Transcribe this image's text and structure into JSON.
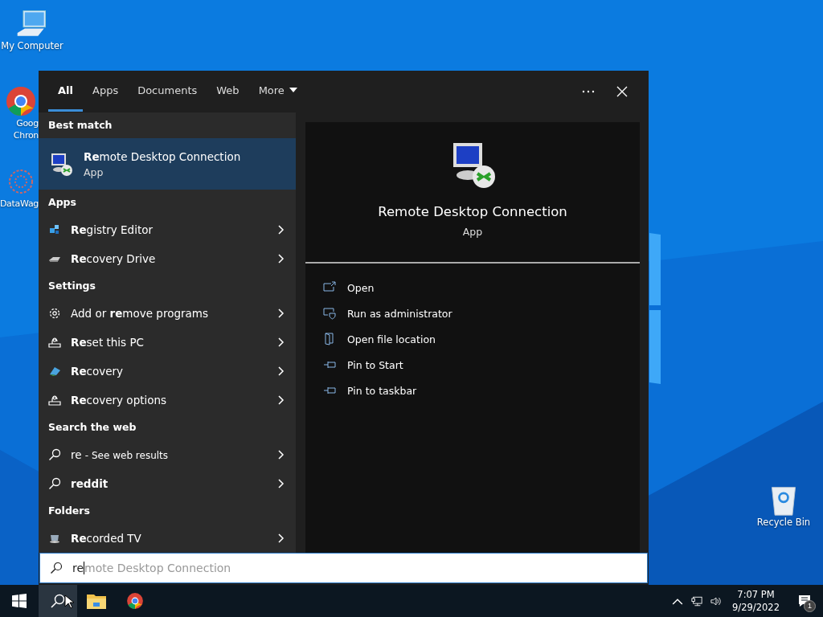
{
  "desktop_icons": [
    {
      "kind": "computer",
      "lines": [
        "My Computer"
      ]
    },
    {
      "kind": "chrome",
      "lines": [
        "Goog",
        "Chron"
      ]
    },
    {
      "kind": "network",
      "lines": [
        "DataWag"
      ]
    },
    {
      "kind": "recycle",
      "lines": [
        "Recycle Bin"
      ]
    }
  ],
  "search_panel": {
    "tabs": [
      {
        "label": "All",
        "selected": true
      },
      {
        "label": "Apps",
        "selected": false
      },
      {
        "label": "Documents",
        "selected": false
      },
      {
        "label": "Web",
        "selected": false
      },
      {
        "label": "More",
        "selected": false,
        "dropdown": true
      }
    ],
    "sections": [
      {
        "heading": "Best match",
        "items": [
          {
            "kind": "rdp",
            "label": "**Re**mote Desktop Connection",
            "subtitle": "App",
            "selected": true,
            "submenu": false
          }
        ]
      },
      {
        "heading": "Apps",
        "items": [
          {
            "kind": "registry",
            "label": "**Re**gistry Editor",
            "selected": false,
            "submenu": true
          },
          {
            "kind": "drive",
            "label": "**Re**covery Drive",
            "selected": false,
            "submenu": true
          }
        ]
      },
      {
        "heading": "Settings",
        "items": [
          {
            "kind": "gear",
            "label": "Add or **re**move programs",
            "selected": false,
            "submenu": true
          },
          {
            "kind": "reset",
            "label": "**Re**set this PC",
            "selected": false,
            "submenu": true
          },
          {
            "kind": "recovery",
            "label": "**Re**covery",
            "selected": false,
            "submenu": true
          },
          {
            "kind": "reset",
            "label": "**Re**covery options",
            "selected": false,
            "submenu": true
          }
        ]
      },
      {
        "heading": "Search the web",
        "items": [
          {
            "kind": "search",
            "label": "re",
            "suffix": "- See web results",
            "selected": false,
            "submenu": true
          },
          {
            "kind": "search",
            "label": "**reddit**",
            "selected": false,
            "submenu": true
          }
        ]
      },
      {
        "heading": "Folders",
        "items": [
          {
            "kind": "tv",
            "label": "**Re**corded TV",
            "selected": false,
            "submenu": true
          }
        ]
      }
    ],
    "preview": {
      "kind": "rdp",
      "title": "Remote Desktop Connection",
      "subtitle": "App",
      "actions": [
        {
          "kind": "open",
          "label": "Open"
        },
        {
          "kind": "admin",
          "label": "Run as administrator"
        },
        {
          "kind": "folder",
          "label": "Open file location"
        },
        {
          "kind": "pin",
          "label": "Pin to Start"
        },
        {
          "kind": "pin",
          "label": "Pin to taskbar"
        }
      ]
    },
    "query": {
      "value": "re",
      "suggestion": "mote Desktop Connection"
    }
  },
  "taskbar": {
    "buttons": [
      {
        "kind": "start",
        "selected": false
      },
      {
        "kind": "search",
        "selected": true
      },
      {
        "kind": "explorer",
        "selected": false
      },
      {
        "kind": "chrome",
        "selected": false
      }
    ],
    "time": "7:07 PM",
    "date": "9/29/2022",
    "notifications": "1"
  }
}
